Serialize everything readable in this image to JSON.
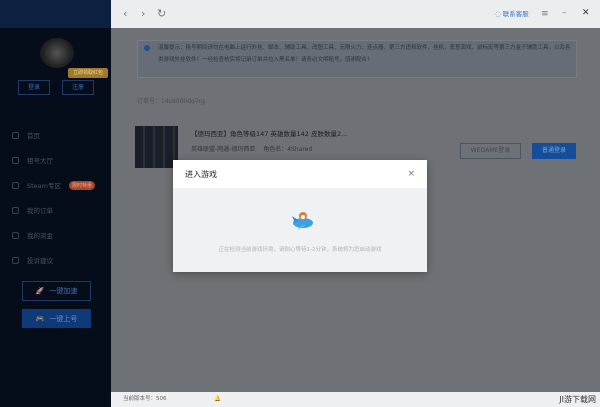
{
  "sidebar": {
    "badge": "立即领取红包",
    "login": "登录",
    "register": "注册",
    "menu": [
      {
        "label": "首页"
      },
      {
        "label": "租号大厅"
      },
      {
        "label": "Steam专区",
        "badge": "限时特惠"
      },
      {
        "label": "我的订单"
      },
      {
        "label": "我的资金"
      },
      {
        "label": "投诉建议"
      }
    ],
    "accelerate": "一键加速",
    "quick_login": "一键上号"
  },
  "header": {
    "back": "‹",
    "forward": "›",
    "refresh": "↻",
    "support": "联系客服",
    "menu": "≡",
    "minimize": "–",
    "close": "✕"
  },
  "main": {
    "notice": "温馨提示：租号期间请勿在电脑上运行外挂、脚本、辅助工具、改图工具、无限火力、连点器、第三方违规软件，挂机，恶意演戏，鼠标宏等第三方盒子辅助工具，以及各类游戏外挂软件！一经检查核实将记录订单并拉入黑名单！请务必文明租号，感谢配合！",
    "order_no": "订单号：14c6000dq7rg",
    "item_title": "【德玛西亚】角色等级147 英雄数量142 皮肤数量2...",
    "item_sub": "英雄联盟-网通-德玛西亚　 角色名：4Shared",
    "wegame_btn": "WEGAME登录",
    "normal_btn": "普通登录"
  },
  "modal": {
    "title": "进入游戏",
    "close": "×",
    "message": "正在检测当前游戏环境，请耐心等待1-2分钟，系统将为您启动游戏"
  },
  "footer": {
    "version": "当前版本号：506"
  },
  "watermark": "JI游下载网"
}
